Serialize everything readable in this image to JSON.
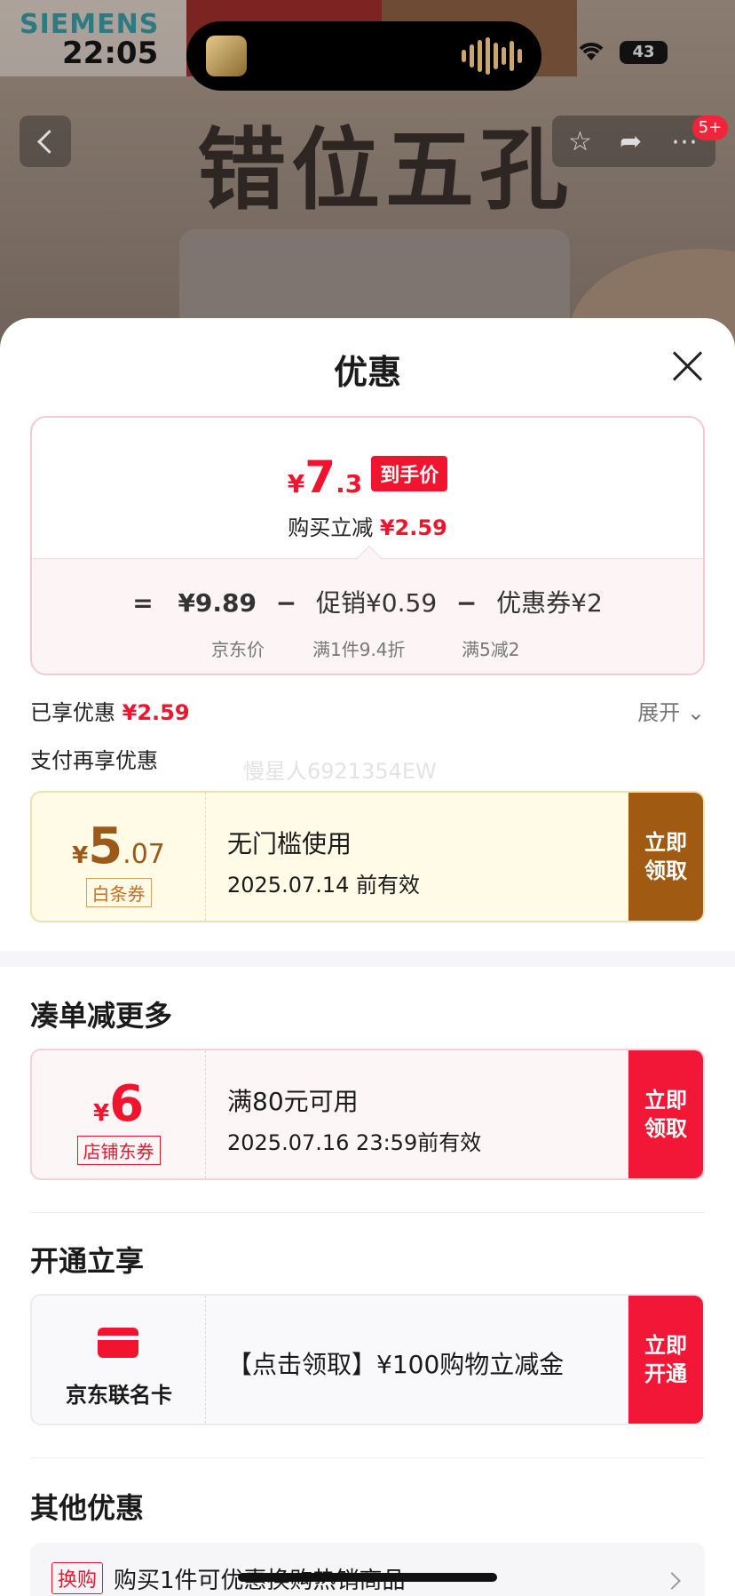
{
  "status_bar": {
    "time": "22:05",
    "battery": "43"
  },
  "background": {
    "brand": "SIEMENS",
    "headline": "错位五孔",
    "badge": "5+"
  },
  "sheet": {
    "title": "优惠",
    "price_card": {
      "yen": "¥",
      "price_int": "7",
      "price_dec": ".3",
      "price_tag": "到手价",
      "sub_label": "购买立减",
      "sub_value": "¥2.59",
      "eq": "=",
      "jd_price": "¥9.89",
      "jd_price_caption": "京东价",
      "minus1": "−",
      "promo": "促销¥0.59",
      "promo_caption": "满1件9.4折",
      "minus2": "−",
      "coupon": "优惠券¥2",
      "coupon_caption": "满5减2"
    },
    "enjoyed_label": "已享优惠",
    "enjoyed_value": "¥2.59",
    "expand_label": "展开",
    "pay_section": "支付再享优惠",
    "watermark": "慢星人6921354EW",
    "pay_coupon": {
      "yen": "¥",
      "int": "5",
      "dec": ".07",
      "tag": "白条券",
      "title": "无门槛使用",
      "validity": "2025.07.14 前有效",
      "action": "立即领取"
    },
    "combine_section": "凑单减更多",
    "store_coupon": {
      "yen": "¥",
      "int": "6",
      "tag": "店铺东券",
      "title": "满80元可用",
      "validity": "2025.07.16 23:59前有效",
      "action": "立即领取"
    },
    "open_section": "开通立享",
    "card_offer": {
      "card_name": "京东联名卡",
      "title": "【点击领取】¥100购物立减金",
      "action": "立即开通"
    },
    "other_section": "其他优惠",
    "other_offer": {
      "tag": "换购",
      "text": "购买1件可优惠换购热销商品"
    }
  }
}
